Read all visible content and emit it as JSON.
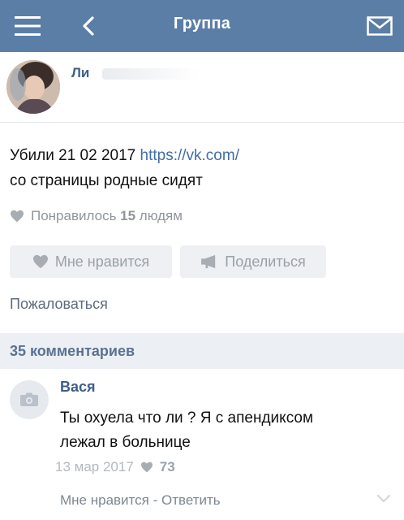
{
  "topbar": {
    "title": "Группа",
    "icons": [
      "menu-icon",
      "back-icon",
      "mail-icon"
    ],
    "color": "#5b7ea6"
  },
  "post": {
    "author_name": "Ли",
    "text_line1": "Убили 21 02 2017 ",
    "link": "https://vk.com/",
    "text_line2": "со страницы родные сидят",
    "likes_prefix": "Понравилось ",
    "likes_count": "15",
    "likes_suffix": " людям",
    "like_button": "Мне нравится",
    "share_button": "Поделиться",
    "report": "Пожаловаться"
  },
  "comments": {
    "header": "35 комментариев",
    "items": [
      {
        "author": "Вася",
        "text_line1": "Ты охуела что ли ? Я с апендиксом",
        "text_line2": "лежал в больнице",
        "date": "13 мар 2017",
        "likes": "73",
        "like_action": "Мне нравится",
        "separator": " - ",
        "reply_action": "Ответить"
      }
    ]
  },
  "colors": {
    "accent": "#5b7ea6",
    "link": "#3f6ea6",
    "muted": "#8f959c"
  }
}
